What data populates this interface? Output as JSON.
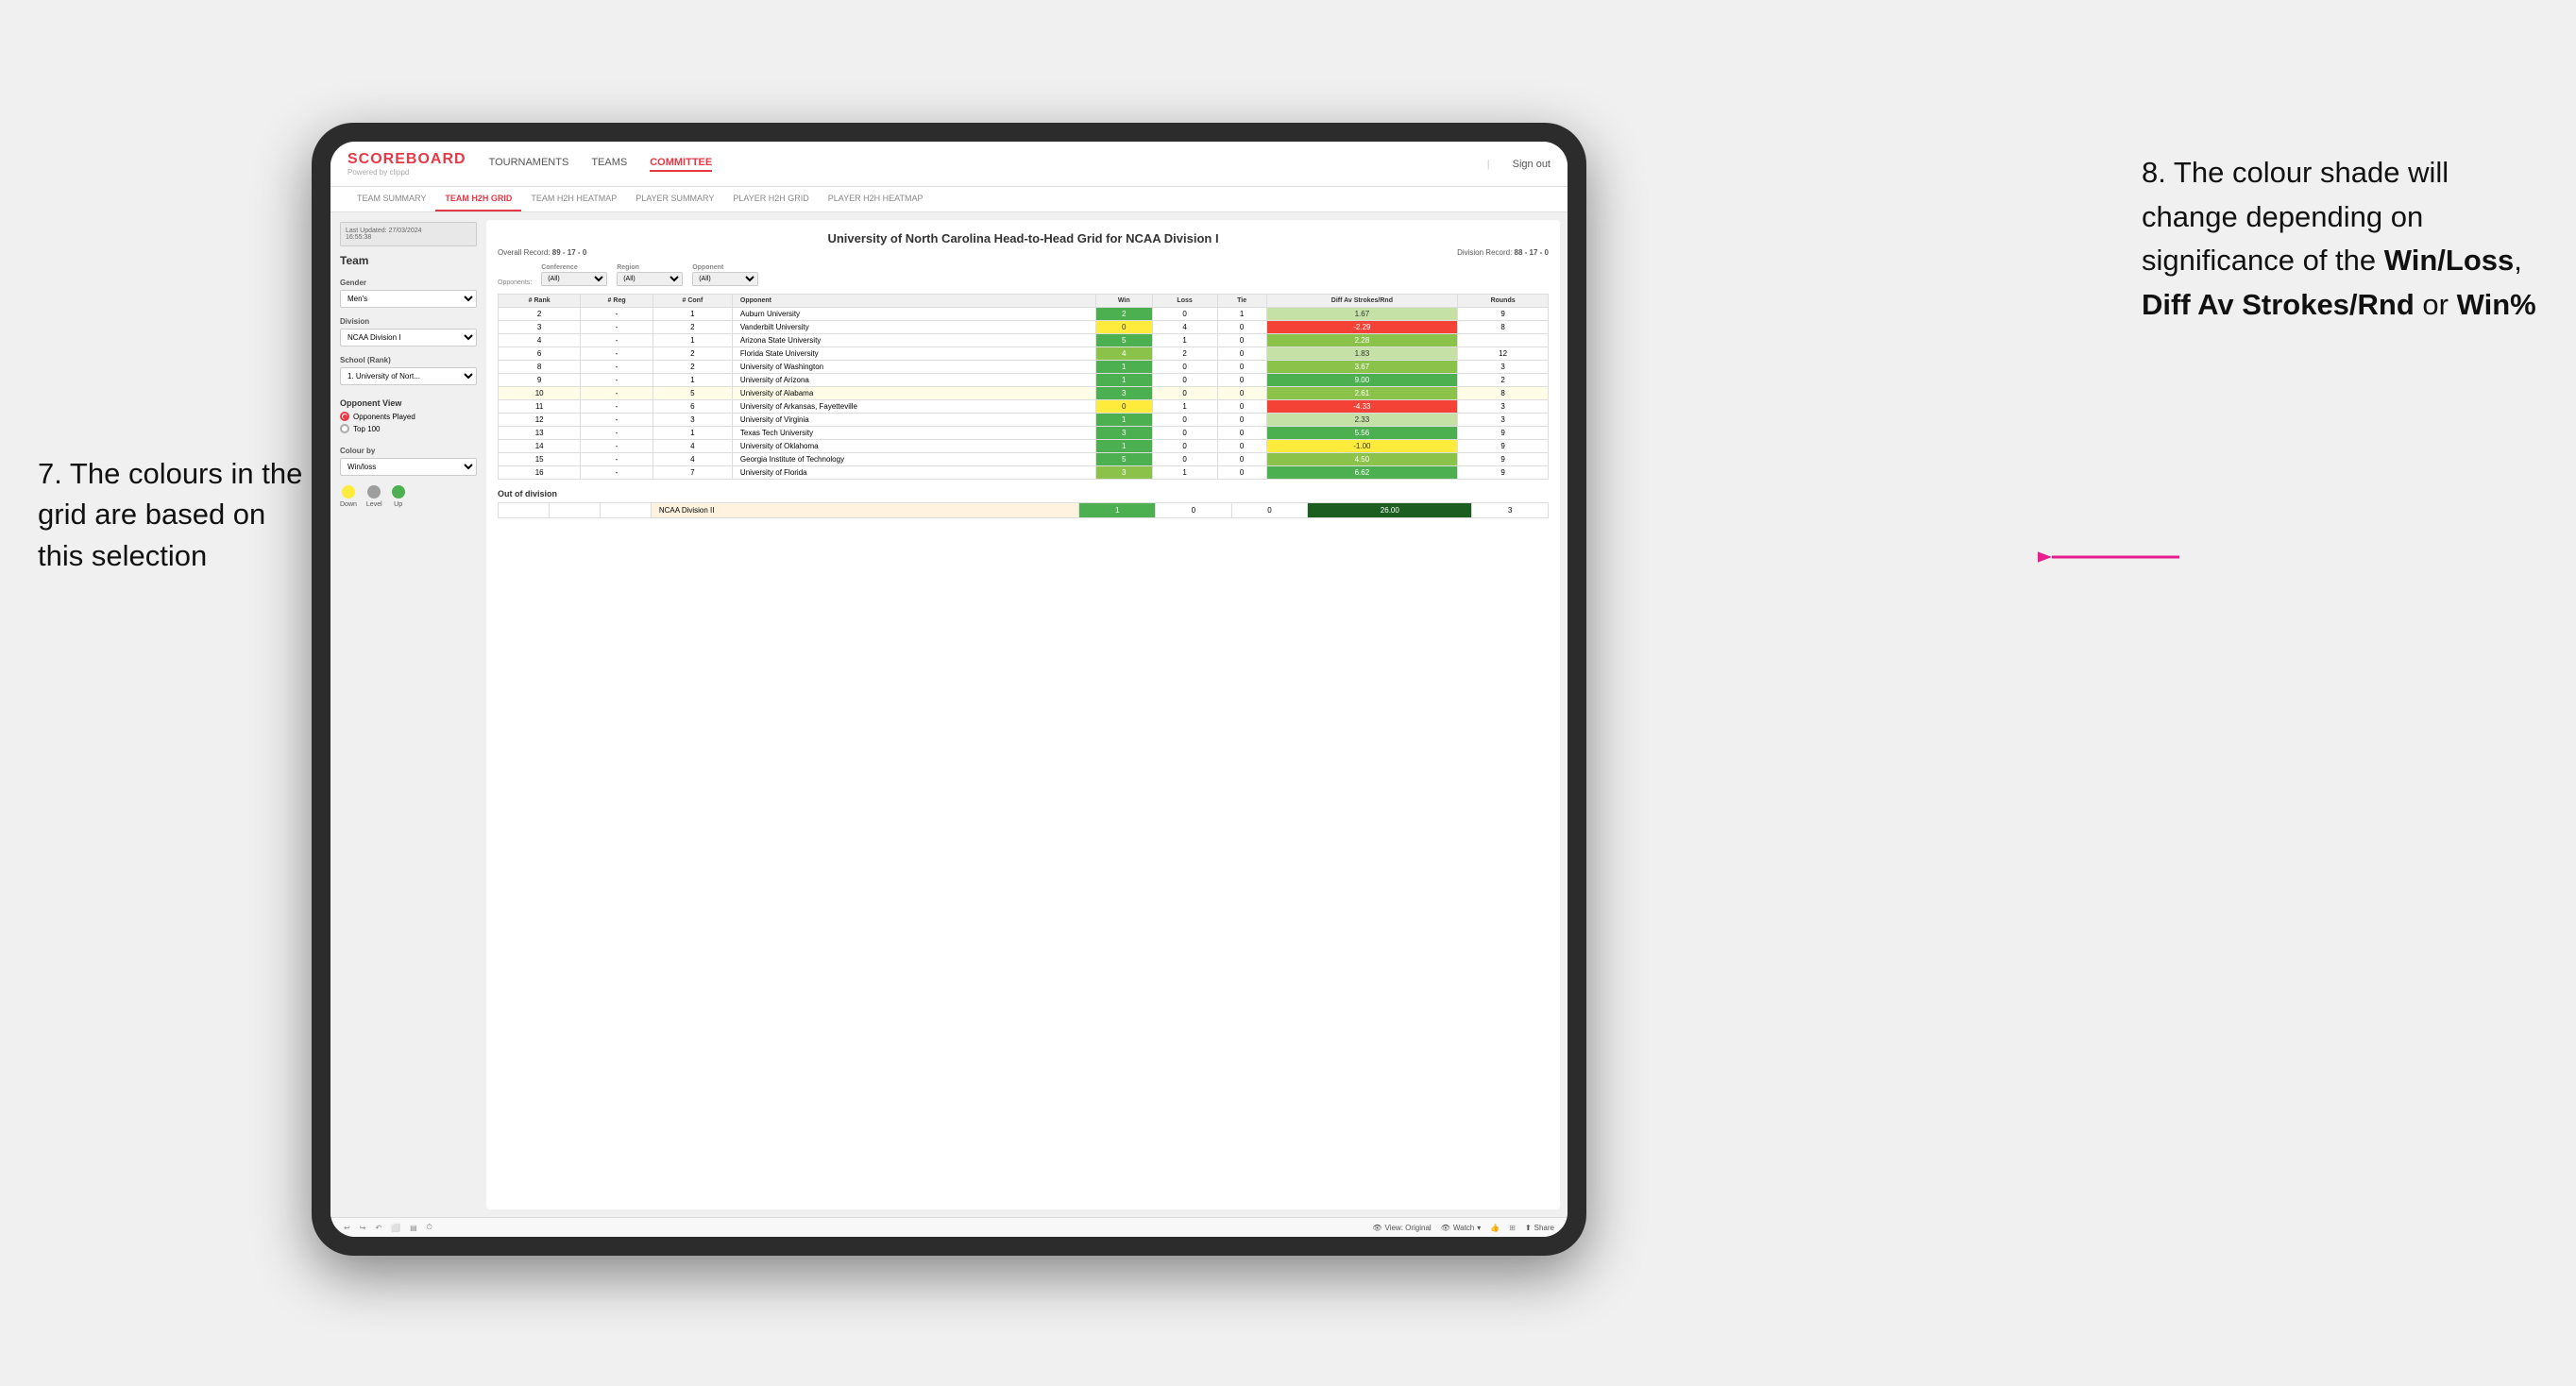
{
  "annotations": {
    "left_number": "7.",
    "left_text": "The colours in the grid are based on this selection",
    "right_number": "8.",
    "right_text": "The colour shade will change depending on significance of the ",
    "right_bold1": "Win/Loss",
    "right_bold2": "Diff Av Strokes/Rnd",
    "right_bold3": "Win%",
    "right_connector": " or "
  },
  "header": {
    "logo": "SCOREBOARD",
    "logo_sub": "Powered by clippd",
    "nav": [
      "TOURNAMENTS",
      "TEAMS",
      "COMMITTEE"
    ],
    "active_nav": "COMMITTEE",
    "sign_out": "Sign out"
  },
  "sub_nav": {
    "items": [
      "TEAM SUMMARY",
      "TEAM H2H GRID",
      "TEAM H2H HEATMAP",
      "PLAYER SUMMARY",
      "PLAYER H2H GRID",
      "PLAYER H2H HEATMAP"
    ],
    "active": "TEAM H2H GRID"
  },
  "sidebar": {
    "last_updated_label": "Last Updated: 27/03/2024",
    "last_updated_time": "16:55:38",
    "team_label": "Team",
    "gender_label": "Gender",
    "gender_value": "Men's",
    "division_label": "Division",
    "division_value": "NCAA Division I",
    "school_label": "School (Rank)",
    "school_value": "1. University of Nort...",
    "opponent_view_label": "Opponent View",
    "radio1": "Opponents Played",
    "radio2": "Top 100",
    "colour_by_label": "Colour by",
    "colour_by_value": "Win/loss",
    "legend": {
      "down_label": "Down",
      "level_label": "Level",
      "up_label": "Up"
    }
  },
  "grid": {
    "title": "University of North Carolina Head-to-Head Grid for NCAA Division I",
    "overall_record": "89 - 17 - 0",
    "division_record": "88 - 17 - 0",
    "filters": {
      "opponents_label": "Opponents:",
      "opponents_value": "(All)",
      "conference_label": "Conference",
      "conference_value": "(All)",
      "region_label": "Region",
      "region_value": "(All)",
      "opponent_label": "Opponent",
      "opponent_value": "(All)"
    },
    "table_headers": [
      "#\nRank",
      "#\nReg",
      "#\nConf",
      "Opponent",
      "Win",
      "Loss",
      "Tie",
      "Diff Av\nStrokes/Rnd",
      "Rounds"
    ],
    "rows": [
      {
        "rank": "2",
        "reg": "-",
        "conf": "1",
        "opponent": "Auburn University",
        "win": "2",
        "loss": "0",
        "tie": "1",
        "diff": "1.67",
        "rounds": "9",
        "win_color": "green_dark",
        "diff_color": "green_light"
      },
      {
        "rank": "3",
        "reg": "-",
        "conf": "2",
        "opponent": "Vanderbilt University",
        "win": "0",
        "loss": "4",
        "tie": "0",
        "diff": "-2.29",
        "rounds": "8",
        "win_color": "yellow",
        "diff_color": "red"
      },
      {
        "rank": "4",
        "reg": "-",
        "conf": "1",
        "opponent": "Arizona State University",
        "win": "5",
        "loss": "1",
        "tie": "0",
        "diff": "2.28",
        "rounds": "",
        "win_color": "green_dark",
        "diff_color": "green_med"
      },
      {
        "rank": "6",
        "reg": "-",
        "conf": "2",
        "opponent": "Florida State University",
        "win": "4",
        "loss": "2",
        "tie": "0",
        "diff": "1.83",
        "rounds": "12",
        "win_color": "green_med",
        "diff_color": "green_light"
      },
      {
        "rank": "8",
        "reg": "-",
        "conf": "2",
        "opponent": "University of Washington",
        "win": "1",
        "loss": "0",
        "tie": "0",
        "diff": "3.67",
        "rounds": "3",
        "win_color": "green_dark",
        "diff_color": "green_med"
      },
      {
        "rank": "9",
        "reg": "-",
        "conf": "1",
        "opponent": "University of Arizona",
        "win": "1",
        "loss": "0",
        "tie": "0",
        "diff": "9.00",
        "rounds": "2",
        "win_color": "green_dark",
        "diff_color": "green_dark"
      },
      {
        "rank": "10",
        "reg": "-",
        "conf": "5",
        "opponent": "University of Alabama",
        "win": "3",
        "loss": "0",
        "tie": "0",
        "diff": "2.61",
        "rounds": "8",
        "win_color": "green_dark",
        "diff_color": "green_med",
        "highlighted": true
      },
      {
        "rank": "11",
        "reg": "-",
        "conf": "6",
        "opponent": "University of Arkansas, Fayetteville",
        "win": "0",
        "loss": "1",
        "tie": "0",
        "diff": "-4.33",
        "rounds": "3",
        "win_color": "yellow",
        "diff_color": "red"
      },
      {
        "rank": "12",
        "reg": "-",
        "conf": "3",
        "opponent": "University of Virginia",
        "win": "1",
        "loss": "0",
        "tie": "0",
        "diff": "2.33",
        "rounds": "3",
        "win_color": "green_dark",
        "diff_color": "green_light"
      },
      {
        "rank": "13",
        "reg": "-",
        "conf": "1",
        "opponent": "Texas Tech University",
        "win": "3",
        "loss": "0",
        "tie": "0",
        "diff": "5.56",
        "rounds": "9",
        "win_color": "green_dark",
        "diff_color": "green_dark"
      },
      {
        "rank": "14",
        "reg": "-",
        "conf": "4",
        "opponent": "University of Oklahoma",
        "win": "1",
        "loss": "0",
        "tie": "0",
        "diff": "-1.00",
        "rounds": "9",
        "win_color": "green_dark",
        "diff_color": "yellow"
      },
      {
        "rank": "15",
        "reg": "-",
        "conf": "4",
        "opponent": "Georgia Institute of Technology",
        "win": "5",
        "loss": "0",
        "tie": "0",
        "diff": "4.50",
        "rounds": "9",
        "win_color": "green_dark",
        "diff_color": "green_med"
      },
      {
        "rank": "16",
        "reg": "-",
        "conf": "7",
        "opponent": "University of Florida",
        "win": "3",
        "loss": "1",
        "tie": "0",
        "diff": "6.62",
        "rounds": "9",
        "win_color": "green_med",
        "diff_color": "green_dark"
      }
    ],
    "out_of_division": {
      "label": "Out of division",
      "rows": [
        {
          "division": "NCAA Division II",
          "win": "1",
          "loss": "0",
          "tie": "0",
          "diff": "26.00",
          "rounds": "3",
          "diff_color": "green_dark"
        }
      ]
    }
  },
  "toolbar": {
    "view_label": "View: Original",
    "watch_label": "Watch",
    "share_label": "Share"
  }
}
